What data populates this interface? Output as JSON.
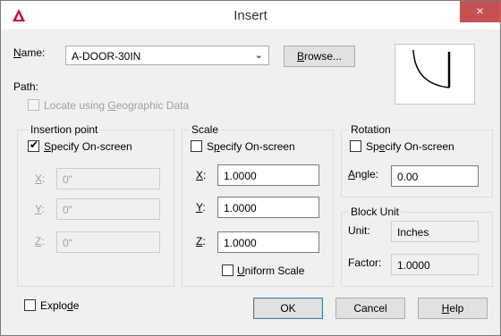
{
  "window": {
    "title": "Insert",
    "close_icon": "×"
  },
  "name_row": {
    "label": "Name:",
    "value": "A-DOOR-30IN",
    "browse_label": "Browse..."
  },
  "path": {
    "label": "Path:"
  },
  "geo": {
    "label": "Locate using Geographic Data",
    "checked": false,
    "disabled": true
  },
  "insertion": {
    "title": "Insertion point",
    "specify_label": "Specify On-screen",
    "specify_checked": true,
    "x_label": "X:",
    "x_value": "0\"",
    "y_label": "Y:",
    "y_value": "0\"",
    "z_label": "Z:",
    "z_value": "0\""
  },
  "scale": {
    "title": "Scale",
    "specify_label": "Specify On-screen",
    "specify_checked": false,
    "x_label": "X:",
    "x_value": "1.0000",
    "y_label": "Y:",
    "y_value": "1.0000",
    "z_label": "Z:",
    "z_value": "1.0000",
    "uniform_label": "Uniform Scale",
    "uniform_checked": false
  },
  "rotation": {
    "title": "Rotation",
    "specify_label": "Specify On-screen",
    "specify_checked": false,
    "angle_label": "Angle:",
    "angle_value": "0.00"
  },
  "block_unit": {
    "title": "Block Unit",
    "unit_label": "Unit:",
    "unit_value": "Inches",
    "factor_label": "Factor:",
    "factor_value": "1.0000"
  },
  "explode": {
    "label": "Explode",
    "checked": false
  },
  "buttons": {
    "ok": "OK",
    "cancel": "Cancel",
    "help": "Help"
  },
  "colors": {
    "close": "#c75050",
    "app_icon": "#c8102e",
    "ok_border": "#3c7fb1"
  }
}
